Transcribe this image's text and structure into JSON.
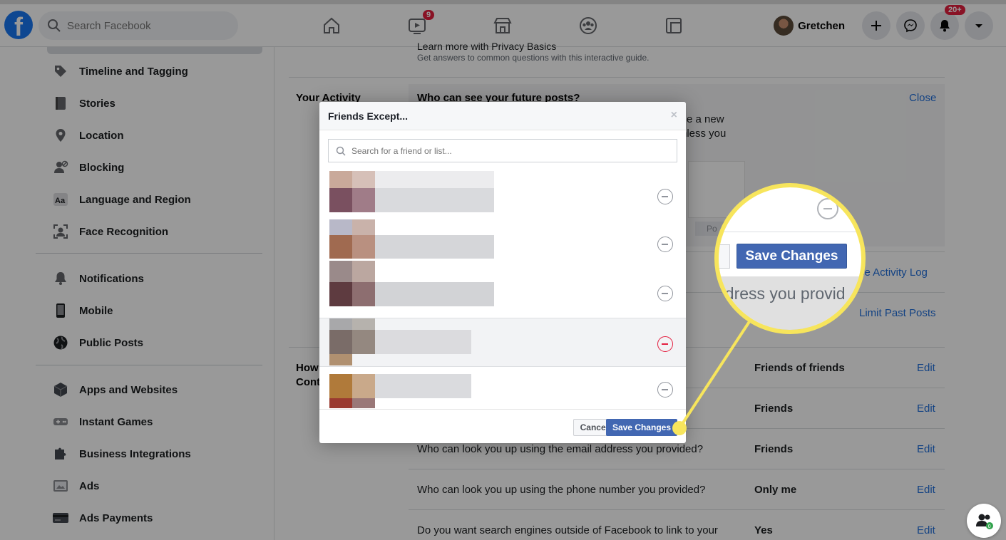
{
  "topbar": {
    "search_placeholder": "Search Facebook",
    "watch_badge": "9",
    "notifications_badge": "20+",
    "profile_name": "Gretchen"
  },
  "sidebar": {
    "items": [
      {
        "label": "Timeline and Tagging",
        "icon": "tag-icon"
      },
      {
        "label": "Stories",
        "icon": "book-icon"
      },
      {
        "label": "Location",
        "icon": "location-pin-icon"
      },
      {
        "label": "Blocking",
        "icon": "block-user-icon"
      },
      {
        "label": "Language and Region",
        "icon": "language-icon"
      },
      {
        "label": "Face Recognition",
        "icon": "face-scan-icon"
      },
      {
        "label": "Notifications",
        "icon": "bell-icon"
      },
      {
        "label": "Mobile",
        "icon": "phone-icon"
      },
      {
        "label": "Public Posts",
        "icon": "globe-icon"
      },
      {
        "label": "Apps and Websites",
        "icon": "cube-icon"
      },
      {
        "label": "Instant Games",
        "icon": "gamepad-icon"
      },
      {
        "label": "Business Integrations",
        "icon": "puzzle-icon"
      },
      {
        "label": "Ads",
        "icon": "ads-icon"
      },
      {
        "label": "Ads Payments",
        "icon": "card-icon"
      }
    ]
  },
  "main": {
    "privacy_basics_title": "Learn more with Privacy Basics",
    "privacy_basics_sub": "Get answers to common questions with this interactive guide.",
    "your_activity_label": "Your Activity",
    "future_posts_question": "Who can see your future posts?",
    "close_link": "Close",
    "partial_text_1": "e a new",
    "partial_text_2": "nless you",
    "activity_log_link": "se Activity Log",
    "limit_past_posts_link": "Limit Past Posts",
    "how_label_1": "How",
    "how_label_2": "Cont",
    "post_btn_partial": "Po",
    "rows": [
      {
        "question": "",
        "value": "Friends of friends",
        "action": "Edit"
      },
      {
        "question": "",
        "value": "Friends",
        "action": "Edit"
      },
      {
        "question": "Who can look you up using the email address you provided?",
        "value": "Friends",
        "action": "Edit"
      },
      {
        "question": "Who can look you up using the phone number you provided?",
        "value": "Only me",
        "action": "Edit"
      },
      {
        "question": "Do you want search engines outside of Facebook to link to your",
        "value": "Yes",
        "action": "Edit"
      }
    ]
  },
  "dialog": {
    "title": "Friends Except...",
    "close_glyph": "×",
    "search_placeholder": "Search for a friend or list...",
    "cancel_label": "Cancel",
    "save_label": "Save Changes"
  },
  "magnifier": {
    "save_label": "Save Changes",
    "text": "ddress you provid"
  },
  "chat_badge": "0"
}
